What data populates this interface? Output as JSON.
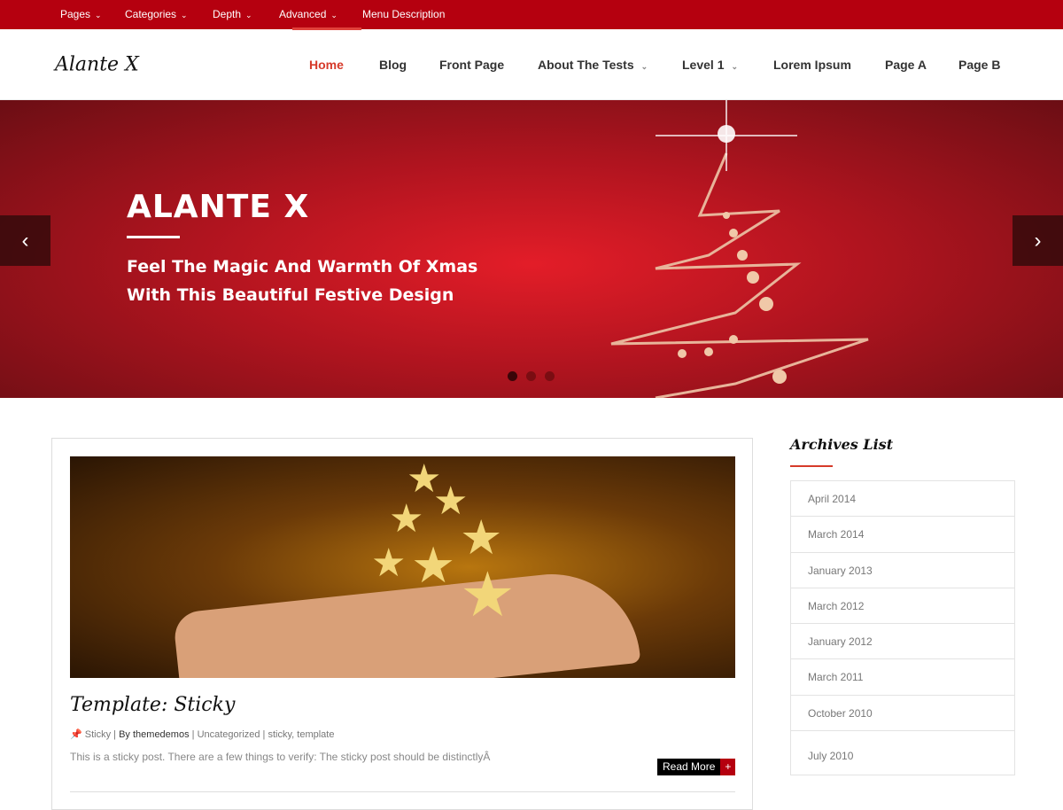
{
  "top_menu": [
    {
      "label": "Pages",
      "has_dropdown": true
    },
    {
      "label": "Categories",
      "has_dropdown": true
    },
    {
      "label": "Depth",
      "has_dropdown": true
    },
    {
      "label": "Advanced",
      "has_dropdown": true
    },
    {
      "label": "Menu Description",
      "has_dropdown": false
    }
  ],
  "site_title": "Alante X",
  "main_menu": [
    {
      "label": "Home",
      "active": true
    },
    {
      "label": "Blog"
    },
    {
      "label": "Front Page"
    },
    {
      "label": "About The Tests",
      "has_dropdown": true
    },
    {
      "label": "Level 1",
      "has_dropdown": true
    },
    {
      "label": "Lorem Ipsum"
    },
    {
      "label": "Page A"
    },
    {
      "label": "Page B"
    }
  ],
  "hero": {
    "title": "ALANTE X",
    "line1": "Feel The Magic And Warmth Of Xmas",
    "line2": "With This Beautiful Festive Design",
    "prev": "‹",
    "next": "›",
    "slides": 3,
    "active_slide": 1
  },
  "post": {
    "title": "Template: Sticky",
    "sticky": "Sticky",
    "author": "By themedemos",
    "category": "Uncategorized",
    "tags": "sticky, template",
    "excerpt": "This is a sticky post. There are a few things to verify: The sticky post should be distinctlyÂ",
    "read_more": "Read More",
    "plus": "+"
  },
  "sidebar": {
    "title": "Archives List",
    "archives": [
      "April 2014",
      "March 2014",
      "January 2013",
      "March 2012",
      "January 2012",
      "March 2011",
      "October 2010",
      "July 2010"
    ]
  },
  "colors": {
    "brand": "#b5000f",
    "accent": "#d63a2a"
  }
}
